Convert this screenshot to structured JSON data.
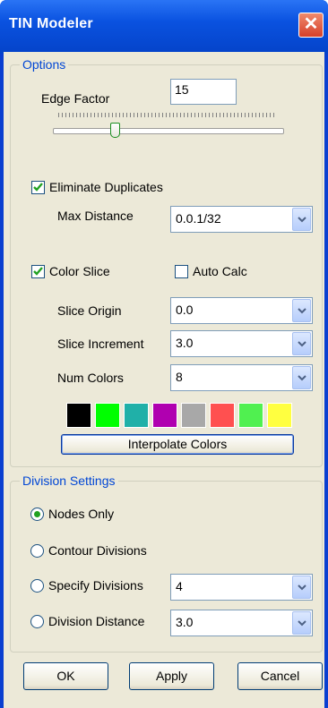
{
  "window": {
    "title": "TIN Modeler",
    "close_symbol": "✕"
  },
  "options": {
    "legend": "Options",
    "edge_factor": {
      "label": "Edge Factor",
      "value": "15",
      "slider_fraction": 0.26
    },
    "eliminate_duplicates": {
      "label": "Eliminate Duplicates",
      "checked": true
    },
    "max_distance": {
      "label": "Max Distance",
      "value": "0.0.1/32"
    },
    "color_slice": {
      "label": "Color Slice",
      "checked": true
    },
    "auto_calc": {
      "label": "Auto Calc",
      "checked": false
    },
    "slice_origin": {
      "label": "Slice Origin",
      "value": "0.0"
    },
    "slice_increment": {
      "label": "Slice Increment",
      "value": "3.0"
    },
    "num_colors": {
      "label": "Num Colors",
      "value": "8"
    },
    "colors": [
      "#000000",
      "#00ff00",
      "#20b0a8",
      "#b000b0",
      "#a8a8a8",
      "#ff5050",
      "#50f050",
      "#ffff40"
    ],
    "interpolate_label": "Interpolate Colors"
  },
  "division": {
    "legend": "Division Settings",
    "nodes_only": {
      "label": "Nodes Only",
      "selected": true
    },
    "contour_divisions": {
      "label": "Contour Divisions",
      "selected": false
    },
    "specify_divisions": {
      "label": "Specify Divisions",
      "selected": false,
      "value": "4"
    },
    "division_distance": {
      "label": "Division Distance",
      "selected": false,
      "value": "3.0"
    }
  },
  "buttons": {
    "ok": "OK",
    "apply": "Apply",
    "cancel": "Cancel"
  }
}
